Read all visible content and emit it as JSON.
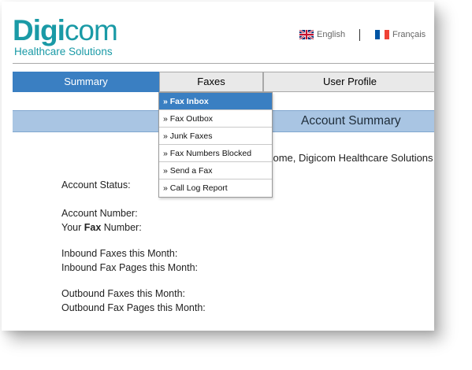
{
  "brand": {
    "name_bold": "Digi",
    "name_light": "com",
    "tagline": "Healthcare Solutions"
  },
  "languages": [
    {
      "label": "English",
      "flag": "uk-flag-icon"
    },
    {
      "label": "Français",
      "flag": "france-flag-icon"
    }
  ],
  "nav": {
    "tabs": [
      {
        "label": "Summary",
        "active": true
      },
      {
        "label": "Faxes",
        "active": false
      },
      {
        "label": "User Profile",
        "active": false
      }
    ]
  },
  "faxes_menu": [
    {
      "label": "» Fax Inbox",
      "highlighted": true
    },
    {
      "label": "» Fax Outbox"
    },
    {
      "label": "» Junk Faxes"
    },
    {
      "label": "» Fax Numbers Blocked"
    },
    {
      "label": "» Send a Fax"
    },
    {
      "label": "» Call Log Report"
    }
  ],
  "summary": {
    "title": "Account Summary",
    "welcome": "come, Digicom Healthcare Solutions",
    "fields": {
      "account_status": "Account Status:",
      "account_number": "Account Number:",
      "your_fax_prefix": "Your ",
      "your_fax_bold": "Fax",
      "your_fax_suffix": " Number:",
      "inbound_faxes": "Inbound Faxes this Month:",
      "inbound_pages": "Inbound Fax Pages this Month:",
      "outbound_faxes": "Outbound Faxes this Month:",
      "outbound_pages": "Outbound Fax Pages this Month:"
    }
  },
  "colors": {
    "brand": "#1a9aa6",
    "nav_active": "#3a7fc2",
    "summary_bar": "#a9c5e3"
  }
}
